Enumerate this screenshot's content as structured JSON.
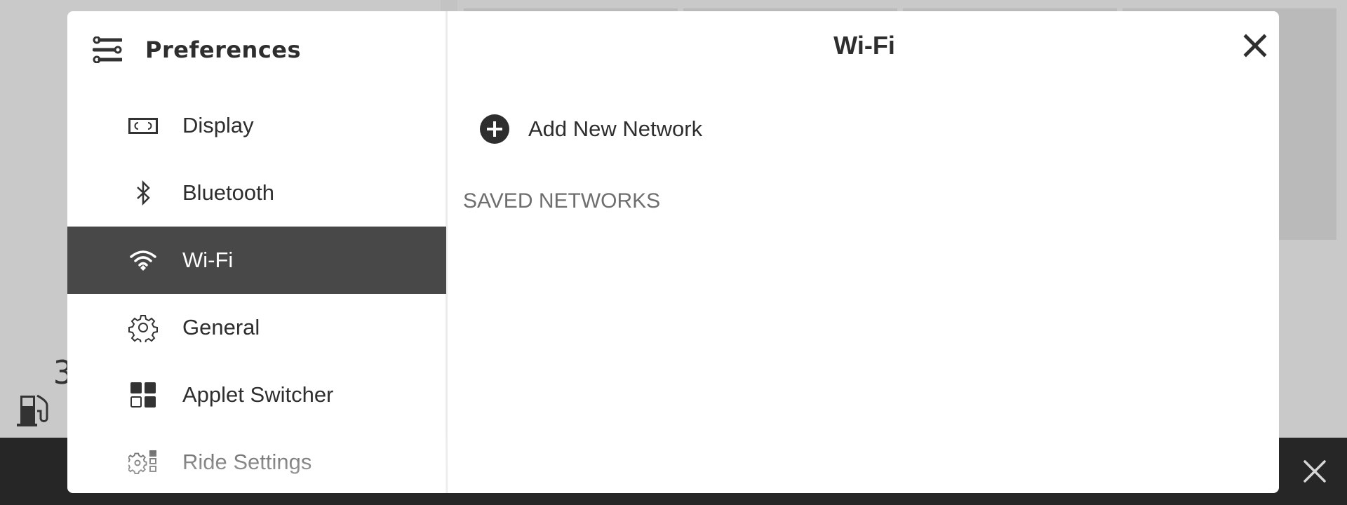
{
  "background": {
    "partial_digit": "3",
    "icons": [
      "fuel-pump-icon",
      "close-icon"
    ]
  },
  "modal": {
    "sidebar": {
      "title": "Preferences",
      "title_icon": "sliders-icon",
      "items": [
        {
          "label": "Display",
          "icon": "display-icon",
          "selected": false
        },
        {
          "label": "Bluetooth",
          "icon": "bluetooth-icon",
          "selected": false
        },
        {
          "label": "Wi-Fi",
          "icon": "wifi-icon",
          "selected": true
        },
        {
          "label": "General",
          "icon": "gear-icon",
          "selected": false
        },
        {
          "label": "Applet Switcher",
          "icon": "grid-icon",
          "selected": false
        },
        {
          "label": "Ride Settings",
          "icon": "ride-settings-icon",
          "selected": false
        }
      ]
    },
    "content": {
      "title": "Wi-Fi",
      "close_icon": "close-icon",
      "add_network_label": "Add New Network",
      "add_network_icon": "plus-circle-icon",
      "saved_networks_header": "SAVED NETWORKS",
      "saved_networks": []
    }
  },
  "colors": {
    "background": "#c9c9c9",
    "selected_row": "#484848",
    "text": "#2e2e2e",
    "section_header": "#6e6e6e",
    "bottom_bar": "#262626"
  }
}
